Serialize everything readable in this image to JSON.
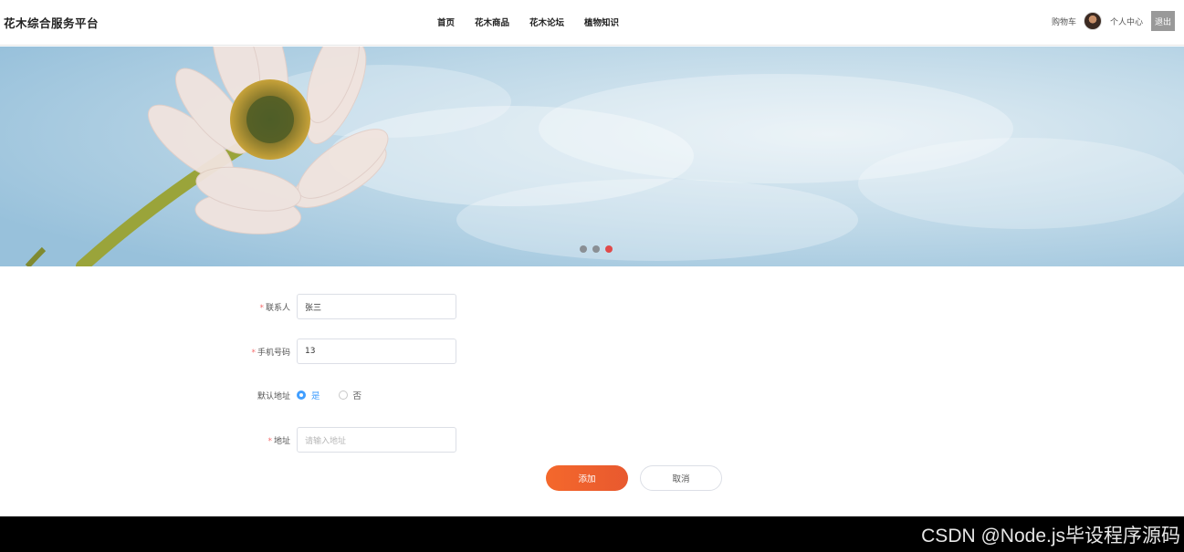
{
  "header": {
    "brand": "花木综合服务平台",
    "nav": [
      "首页",
      "花木商品",
      "花木论坛",
      "植物知识"
    ],
    "cart": "购物车",
    "user_center": "个人中心",
    "logout": "退出"
  },
  "banner": {
    "dots": 3,
    "active_dot": 3
  },
  "form": {
    "contact_label": "联系人",
    "contact_value": "张三",
    "phone_label": "手机号码",
    "phone_value": "13",
    "default_label": "默认地址",
    "default_yes": "是",
    "default_no": "否",
    "address_label": "地址",
    "address_placeholder": "请输入地址",
    "required_mark": "*",
    "add_button": "添加",
    "cancel_button": "取消"
  },
  "footer": {
    "watermark": "CSDN @Node.js毕设程序源码"
  },
  "colors": {
    "accent": "#409eff",
    "primary_button": "#f4682c",
    "active_dot": "#e04a4a"
  }
}
